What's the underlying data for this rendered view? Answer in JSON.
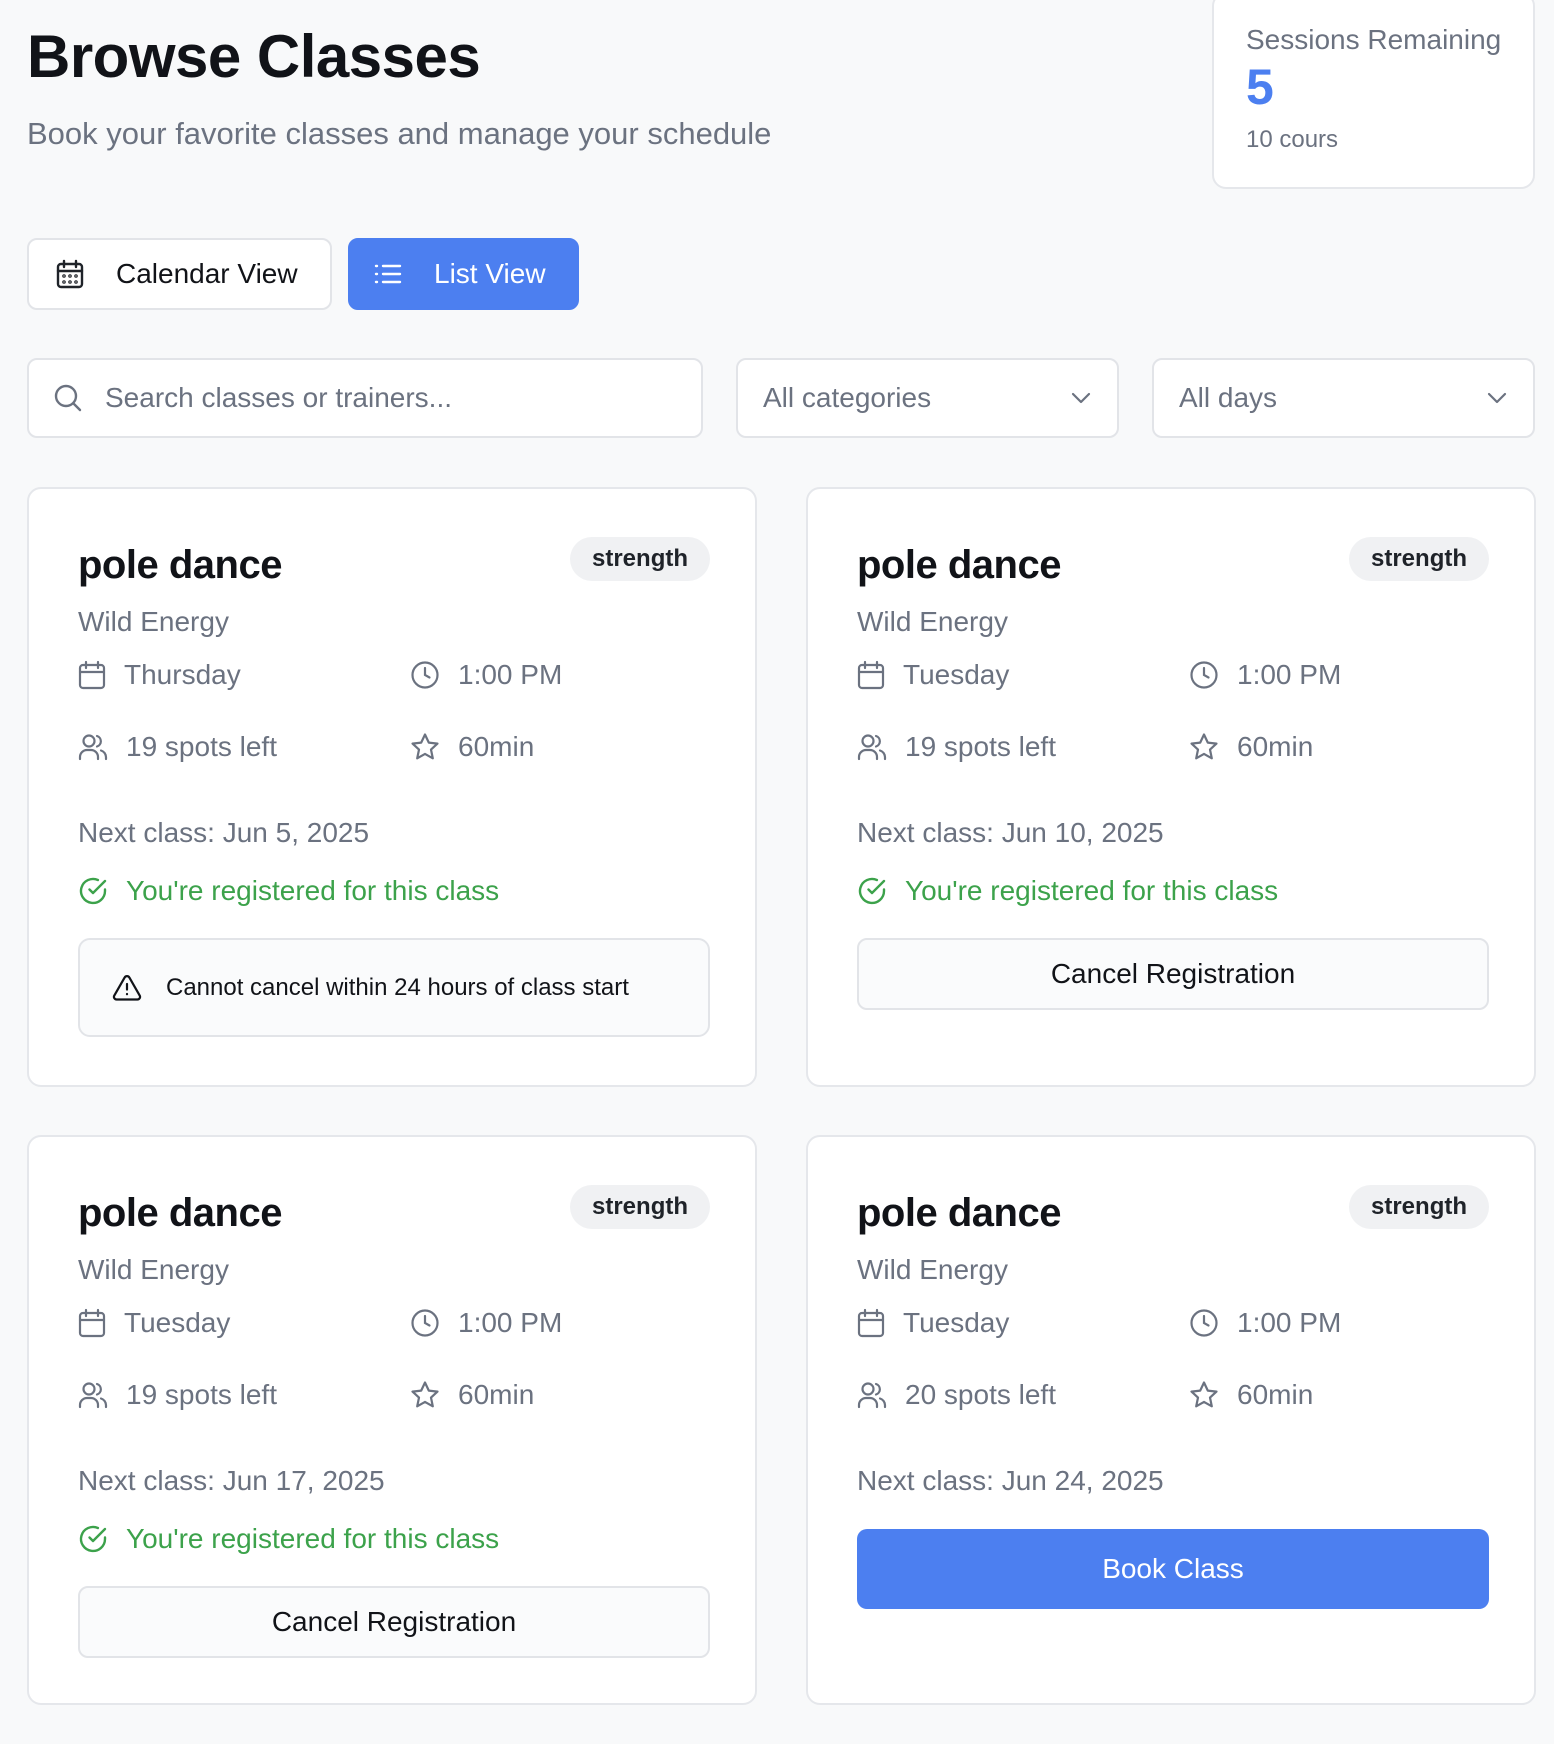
{
  "header": {
    "title": "Browse Classes",
    "subtitle": "Book your favorite classes and manage your schedule"
  },
  "sessions": {
    "label": "Sessions Remaining",
    "count": "5",
    "sub": "10 cours"
  },
  "view_toggle": {
    "calendar_label": "Calendar View",
    "list_label": "List View",
    "active": "list"
  },
  "filters": {
    "search_placeholder": "Search classes or trainers...",
    "category_selected": "All categories",
    "day_selected": "All days"
  },
  "colors": {
    "accent": "#4c7ff0",
    "success": "#3ca24b",
    "muted": "#6b7280"
  },
  "classes": [
    {
      "name": "pole dance",
      "category": "strength",
      "trainer": "Wild Energy",
      "day": "Thursday",
      "time": "1:00 PM",
      "spots": "19 spots left",
      "duration": "60min",
      "next_class": "Next class: Jun 5, 2025",
      "registered_text": "You're registered for this class",
      "warning_text": "Cannot cancel within 24 hours of class start"
    },
    {
      "name": "pole dance",
      "category": "strength",
      "trainer": "Wild Energy",
      "day": "Tuesday",
      "time": "1:00 PM",
      "spots": "19 spots left",
      "duration": "60min",
      "next_class": "Next class: Jun 10, 2025",
      "registered_text": "You're registered for this class",
      "action_label": "Cancel Registration"
    },
    {
      "name": "pole dance",
      "category": "strength",
      "trainer": "Wild Energy",
      "day": "Tuesday",
      "time": "1:00 PM",
      "spots": "19 spots left",
      "duration": "60min",
      "next_class": "Next class: Jun 17, 2025",
      "registered_text": "You're registered for this class",
      "action_label": "Cancel Registration"
    },
    {
      "name": "pole dance",
      "category": "strength",
      "trainer": "Wild Energy",
      "day": "Tuesday",
      "time": "1:00 PM",
      "spots": "20 spots left",
      "duration": "60min",
      "next_class": "Next class: Jun 24, 2025",
      "action_label": "Book Class"
    }
  ]
}
